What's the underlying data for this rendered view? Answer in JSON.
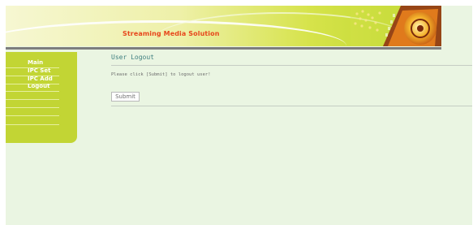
{
  "banner": {
    "title": "Streaming Media Solution"
  },
  "sidebar": {
    "items": [
      {
        "label": "Main"
      },
      {
        "label": "IPC Set"
      },
      {
        "label": "IPC Add"
      },
      {
        "label": "Logout"
      }
    ]
  },
  "main": {
    "title": "User Logout",
    "instruction": "Please click [Submit] to logout user!",
    "submit_label": "Submit"
  },
  "colors": {
    "page_background": "#eaf5e2",
    "sidebar": "#c2d534",
    "banner_title": "#e7471c",
    "title_text": "#3e7f7f"
  },
  "icons": [
    "film-reel-banner-graphic"
  ]
}
